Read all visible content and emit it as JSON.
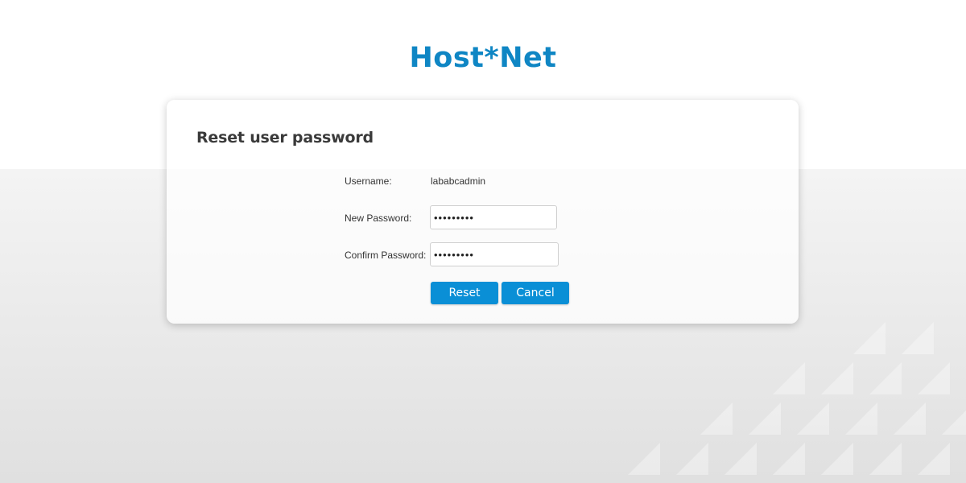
{
  "brand": {
    "logo_text": "Host*Net",
    "color": "#0f86c4"
  },
  "form": {
    "title": "Reset user password",
    "username_label": "Username:",
    "username_value": "lababcadmin",
    "new_password_label": "New Password:",
    "new_password_value": "passw0rd!",
    "confirm_password_label": "Confirm Password:",
    "confirm_password_value": "passw0rd!"
  },
  "actions": {
    "reset_label": "Reset",
    "cancel_label": "Cancel",
    "button_color": "#0a8fd6"
  }
}
